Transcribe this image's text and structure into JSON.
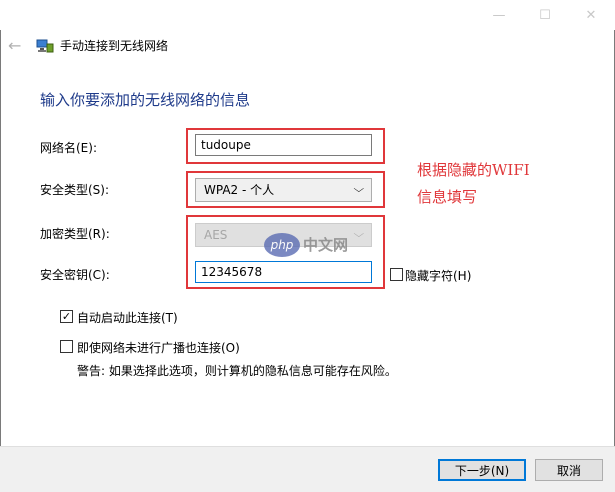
{
  "window": {
    "header_title": "手动连接到无线网络",
    "minimize_glyph": "—",
    "maximize_glyph": "☐",
    "close_glyph": "✕",
    "back_glyph": "←"
  },
  "form": {
    "heading": "输入你要添加的无线网络的信息",
    "network_name": {
      "label": "网络名(E):",
      "value": "tudoupe"
    },
    "security_type": {
      "label": "安全类型(S):",
      "value": "WPA2 - 个人"
    },
    "encryption_type": {
      "label": "加密类型(R):",
      "value": "AES"
    },
    "security_key": {
      "label": "安全密钥(C):",
      "value": "12345678"
    },
    "hide_chars": {
      "label": "隐藏字符(H)",
      "checked": false
    },
    "auto_start": {
      "label": "自动启动此连接(T)",
      "checked": true,
      "check_glyph": "✓"
    },
    "connect_hidden": {
      "label": "即使网络未进行广播也连接(O)",
      "checked": false
    },
    "warning": "警告: 如果选择此选项，则计算机的隐私信息可能存在风险。"
  },
  "annotation": {
    "line1": "根据隐藏的WIFI",
    "line2": "信息填写",
    "color": "#e0373a"
  },
  "watermark": {
    "logo": "php",
    "text": "中文网"
  },
  "buttons": {
    "next": "下一步(N)",
    "cancel": "取消"
  },
  "colors": {
    "heading": "#1e3a8a",
    "accent": "#0078d7"
  }
}
